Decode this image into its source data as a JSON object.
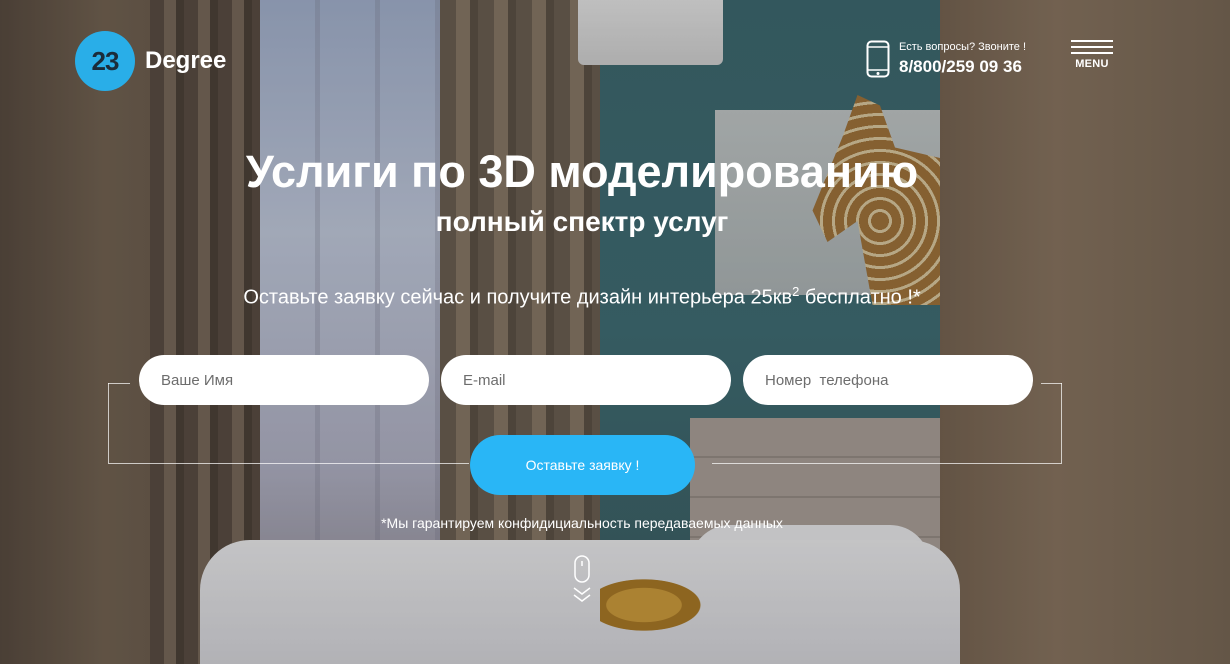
{
  "brand": {
    "logo_number": "23",
    "logo_text": "Degree",
    "accent_color": "#29aee8"
  },
  "contact": {
    "caption": "Есть вопросы? Звоните !",
    "phone": "8/800/259 09 36",
    "icon": "smartphone-icon"
  },
  "menu": {
    "label": "MENU",
    "icon": "hamburger-icon"
  },
  "hero": {
    "title": "Услиги по 3D моделированию",
    "subtitle": "полный спектр услуг",
    "offer_text": "Оставьте заявку сейчас и получите дизайн интерьера 25кв",
    "offer_sup": "2",
    "offer_tail": " бесплатно !*"
  },
  "form": {
    "name_placeholder": "Ваше Имя",
    "email_placeholder": "E-mail",
    "phone_placeholder": "Номер  телефона",
    "submit_label": "Оставьте заявку !",
    "submit_color": "#29b6f6",
    "privacy_note": "*Мы гарантируем конфидициальность передаваемых данных"
  },
  "scroll_indicator": {
    "icon": "scroll-down-icon"
  }
}
